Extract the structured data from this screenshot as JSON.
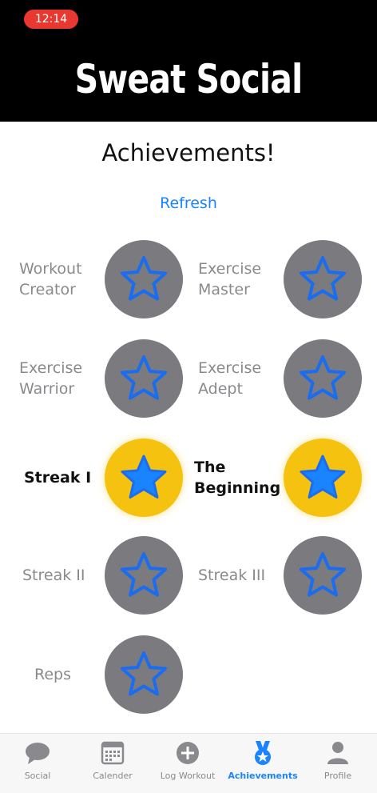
{
  "status_bar": {
    "time": "12:14"
  },
  "header": {
    "brand": "Sweat Social"
  },
  "page": {
    "title": "Achievements!",
    "refresh_label": "Refresh"
  },
  "achievements": [
    {
      "label": "Workout Creator",
      "earned": false
    },
    {
      "label": "Exercise Master",
      "earned": false
    },
    {
      "label": "Exercise Warrior",
      "earned": false
    },
    {
      "label": "Exercise Adept",
      "earned": false
    },
    {
      "label": "Streak I",
      "earned": true
    },
    {
      "label": "The Beginning",
      "earned": true
    },
    {
      "label": "Streak II",
      "earned": false
    },
    {
      "label": "Streak III",
      "earned": false
    },
    {
      "label": "Reps",
      "earned": false
    }
  ],
  "colors": {
    "locked_badge": "#7a7a7f",
    "earned_badge": "#f5c20f",
    "star_outline": "#1a6cf0",
    "star_fill": "#1a84ff",
    "accent": "#1a84ff"
  },
  "tabs": [
    {
      "label": "Social",
      "icon": "chat-bubble-icon",
      "active": false
    },
    {
      "label": "Calender",
      "icon": "calendar-icon",
      "active": false
    },
    {
      "label": "Log Workout",
      "icon": "plus-circle-icon",
      "active": false
    },
    {
      "label": "Achievements",
      "icon": "medal-icon",
      "active": true
    },
    {
      "label": "Profile",
      "icon": "person-icon",
      "active": false
    }
  ]
}
